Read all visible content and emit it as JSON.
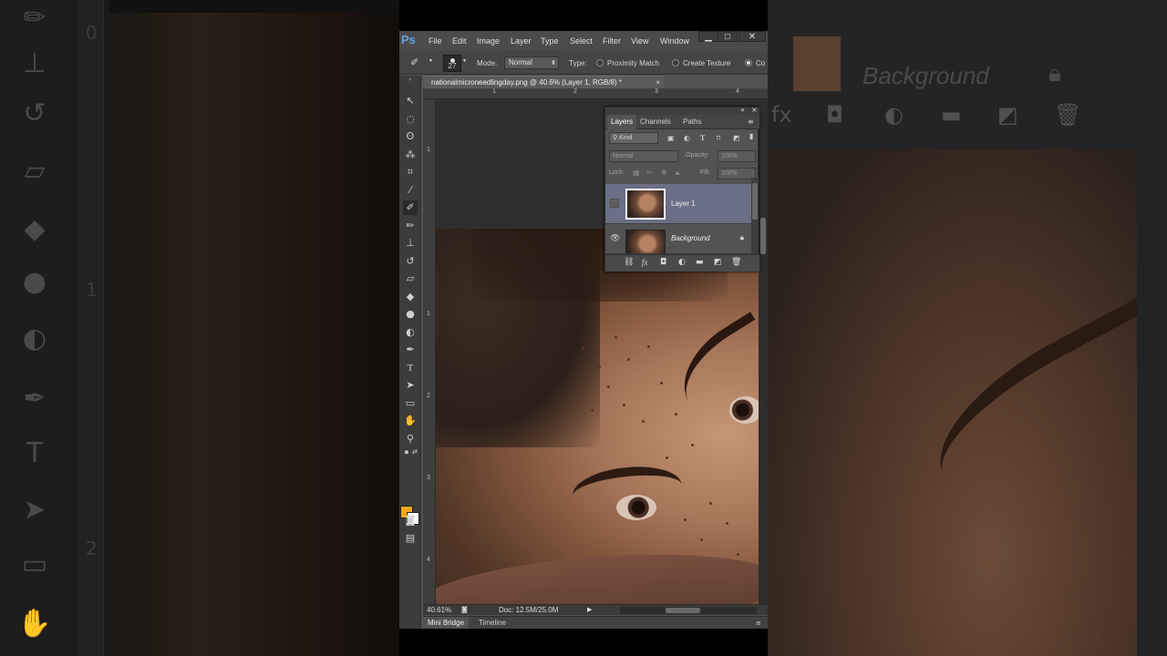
{
  "app": {
    "logo": "Ps",
    "menu": [
      "File",
      "Edit",
      "Image",
      "Layer",
      "Type",
      "Select",
      "Filter",
      "View",
      "Window"
    ],
    "window_controls": {
      "minimize": "▁",
      "maximize": "□",
      "close": "✕"
    }
  },
  "options_bar": {
    "brush_size": "27",
    "mode_label": "Mode:",
    "mode_value": "Normal",
    "type_label": "Type:",
    "type_options": [
      "Proximity Match",
      "Create Texture",
      "Co"
    ],
    "type_selected": "Co"
  },
  "document": {
    "tab_title": "nationalmicroneedlingday.png @ 40.6% (Layer 1, RGB/8) *",
    "tab_close": "×",
    "ruler_h": [
      "1",
      "2",
      "3",
      "4"
    ],
    "ruler_v": [
      "1",
      "1",
      "2",
      "3",
      "4"
    ],
    "zoom": "40.61%",
    "doc_size": "Doc: 12.5M/25.0M"
  },
  "tools": [
    {
      "name": "move-tool-icon",
      "glyph": "▸✥"
    },
    {
      "name": "marquee-tool-icon",
      "glyph": "◌"
    },
    {
      "name": "lasso-tool-icon",
      "glyph": "ʘ"
    },
    {
      "name": "quick-select-tool-icon",
      "glyph": "✎"
    },
    {
      "name": "crop-tool-icon",
      "glyph": "⌗"
    },
    {
      "name": "eyedropper-tool-icon",
      "glyph": "⁄"
    },
    {
      "name": "healing-brush-tool-icon",
      "glyph": "✚"
    },
    {
      "name": "brush-tool-icon",
      "glyph": "✏"
    },
    {
      "name": "clone-stamp-tool-icon",
      "glyph": "⊥"
    },
    {
      "name": "history-brush-tool-icon",
      "glyph": "↺"
    },
    {
      "name": "eraser-tool-icon",
      "glyph": "▱"
    },
    {
      "name": "paint-bucket-tool-icon",
      "glyph": "◆"
    },
    {
      "name": "blur-tool-icon",
      "glyph": "●"
    },
    {
      "name": "dodge-tool-icon",
      "glyph": "◐"
    },
    {
      "name": "pen-tool-icon",
      "glyph": "✒"
    },
    {
      "name": "type-tool-icon",
      "glyph": "T"
    },
    {
      "name": "path-select-tool-icon",
      "glyph": "➤"
    },
    {
      "name": "shape-tool-icon",
      "glyph": "▭"
    },
    {
      "name": "hand-tool-icon",
      "glyph": "✋"
    },
    {
      "name": "zoom-tool-icon",
      "glyph": "⚲"
    }
  ],
  "colors": {
    "foreground": "#f4a819",
    "background": "#ffffff",
    "selection": "#6a6f85"
  },
  "layers_panel": {
    "tabs": [
      "Layers",
      "Channels",
      "Paths"
    ],
    "active_tab": "Layers",
    "filter_kind": "Kind",
    "blend_mode": "Normal",
    "opacity_label": "Opacity:",
    "opacity_value": "100%",
    "lock_label": "Lock:",
    "fill_label": "Fill:",
    "fill_value": "100%",
    "layers": [
      {
        "name": "Layer 1",
        "selected": true,
        "visible": false,
        "locked": false
      },
      {
        "name": "Background",
        "selected": false,
        "visible": true,
        "locked": true
      }
    ]
  },
  "bottom_tabs": [
    "Mini Bridge",
    "Timeline"
  ],
  "blurred_right": {
    "label": "Background"
  },
  "blurred_left": {
    "ruler": [
      "0",
      "1",
      "2"
    ]
  }
}
